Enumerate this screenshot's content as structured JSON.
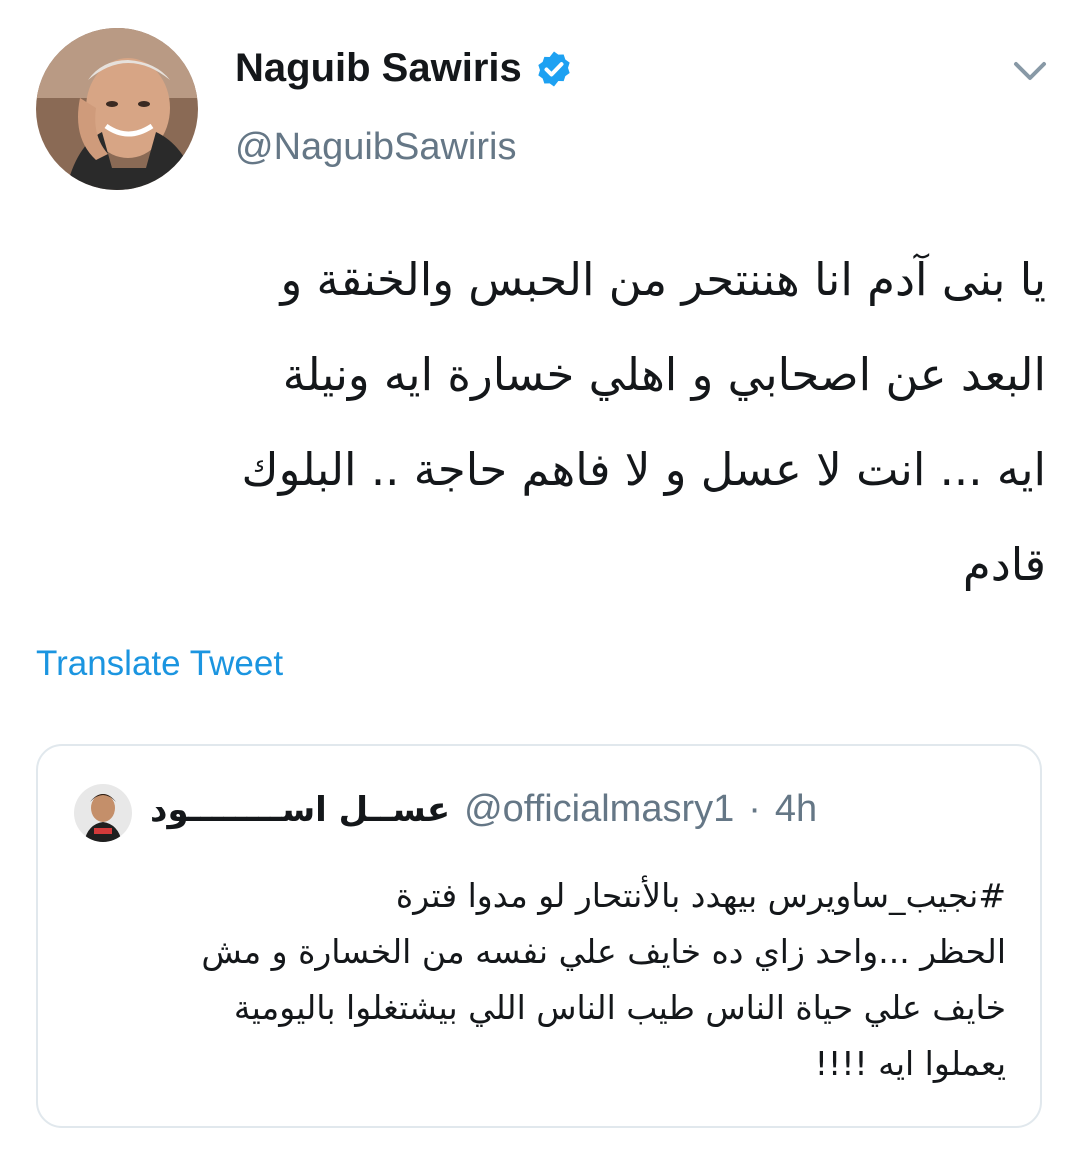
{
  "author": {
    "display_name": "Naguib Sawiris",
    "handle": "@NaguibSawiris",
    "verified_icon": "verified-badge-icon",
    "avatar_icon": "profile-photo"
  },
  "menu_icon": "chevron-down-icon",
  "tweet": {
    "lines": [
      "يا بنى آدم انا هننتحر من الحبس والخنقة و",
      "البعد عن اصحابي و اهلي خسارة ايه ونيلة",
      "ايه ... انت لا عسل و لا فاهم حاجة .. البلوك",
      "قادم"
    ]
  },
  "translate_label": "Translate Tweet",
  "quote": {
    "display_name": "عســل اســــــــود",
    "handle": "@officialmasry1",
    "separator": "·",
    "time": "4h",
    "lines": [
      "#نجيب_ساويرس بيهدد بالأنتحار لو مدوا فترة",
      "الحظر ...واحد زاي ده خايف علي نفسه من الخسارة و مش",
      "خايف علي حياة الناس طيب الناس اللي بيشتغلوا باليومية",
      "يعملوا ايه !!!!"
    ]
  },
  "colors": {
    "link": "#1b95e0",
    "secondary_text": "#657786",
    "verified": "#1da1f2",
    "border": "#e1e8ed"
  }
}
